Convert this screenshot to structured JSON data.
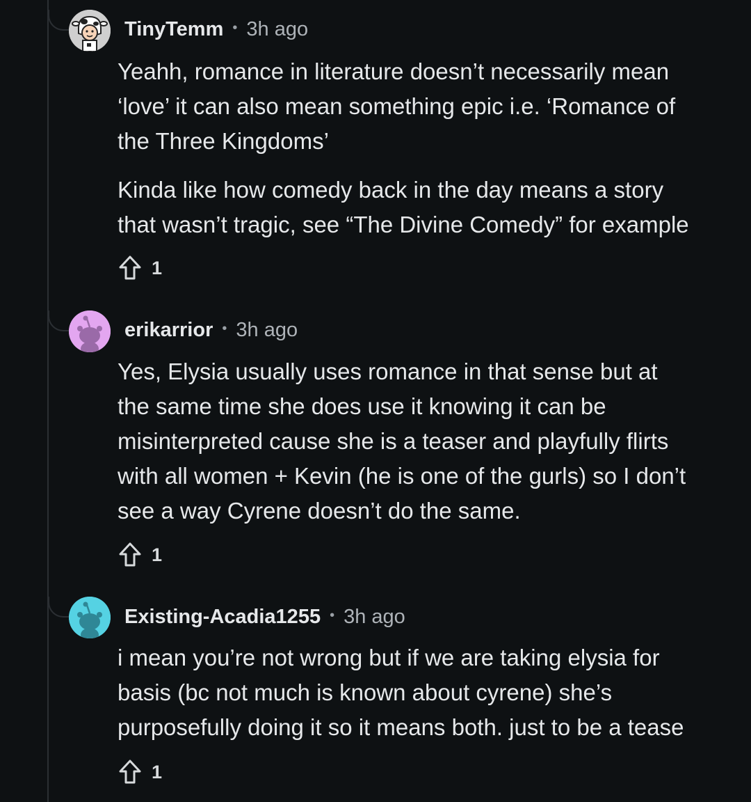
{
  "comments": [
    {
      "username": "TinyTemm",
      "separator": "•",
      "time": "3h ago",
      "avatar_icon": "cow-avatar-icon",
      "paragraphs": [
        "Yeahh, romance in literature doesn’t necessarily mean\n‘love’ it can also mean something epic i.e. ‘Romance of\nthe Three Kingdoms’",
        "Kinda like how comedy back in the day means a story\nthat wasn’t tragic, see “The Divine Comedy” for example"
      ],
      "votes": "1"
    },
    {
      "username": "erikarrior",
      "separator": "•",
      "time": "3h ago",
      "avatar_icon": "snoo-avatar-icon",
      "avatar_color": "#e3a6f0",
      "paragraphs": [
        "Yes, Elysia usually uses romance in that sense but at\nthe same time she does use it knowing it can be\nmisinterpreted cause she is a teaser and playfully flirts\nwith all women + Kevin (he is one of the gurls) so I don’t\nsee a way Cyrene doesn’t do the same."
      ],
      "votes": "1"
    },
    {
      "username": "Existing-Acadia1255",
      "separator": "•",
      "time": "3h ago",
      "avatar_icon": "snoo-avatar-icon",
      "avatar_color": "#55d2e3",
      "paragraphs": [
        "i mean you’re not wrong but if we are taking elysia for\nbasis (bc not much is known about cyrene) she’s\npurposefully doing it so it means both. just to be a tease"
      ],
      "votes": "1"
    }
  ]
}
